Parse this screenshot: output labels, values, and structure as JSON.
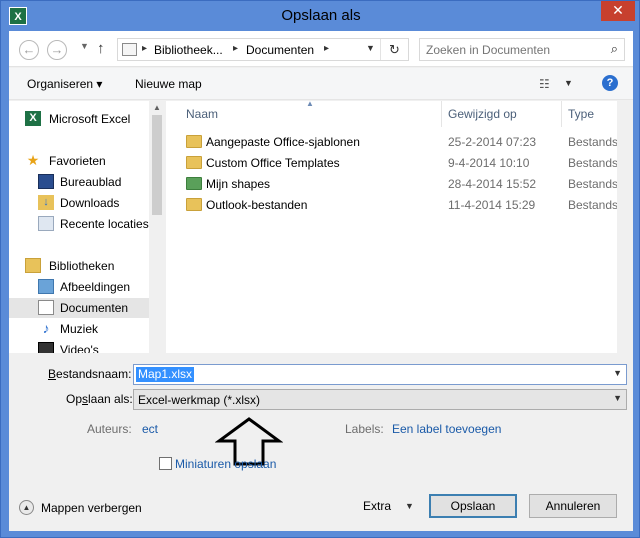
{
  "window": {
    "title": "Opslaan als",
    "app_icon_text": "X",
    "close_glyph": "✕"
  },
  "address": {
    "back_glyph": "←",
    "forward_glyph": "→",
    "up_glyph": "↑",
    "crumbs": [
      "Bibliotheek...",
      "Documenten"
    ],
    "refresh_glyph": "↻",
    "search_placeholder": "Zoeken in Documenten"
  },
  "toolbar": {
    "organize_label": "Organiseren ▾",
    "new_folder_label": "Nieuwe map",
    "view_glyph": "☷",
    "help_glyph": "?"
  },
  "nav": {
    "items": [
      {
        "label": "Microsoft Excel",
        "icon": "excel-icon"
      },
      {
        "label": "Favorieten",
        "icon": "star-icon"
      },
      {
        "label": "Bureaublad",
        "icon": "desktop-icon"
      },
      {
        "label": "Downloads",
        "icon": "downloads-icon"
      },
      {
        "label": "Recente locaties",
        "icon": "recent-places-icon"
      },
      {
        "label": "Bibliotheken",
        "icon": "libraries-icon"
      },
      {
        "label": "Afbeeldingen",
        "icon": "pictures-icon"
      },
      {
        "label": "Documenten",
        "icon": "documents-icon"
      },
      {
        "label": "Muziek",
        "icon": "music-icon"
      },
      {
        "label": "Video's",
        "icon": "video-icon"
      }
    ]
  },
  "files": {
    "columns": [
      "Naam",
      "Gewijzigd op",
      "Type"
    ],
    "rows": [
      {
        "name": "Aangepaste Office-sjablonen",
        "date": "25-2-2014 07:23",
        "type": "Bestandsmap"
      },
      {
        "name": "Custom Office Templates",
        "date": "9-4-2014 10:10",
        "type": "Bestandsmap"
      },
      {
        "name": "Mijn shapes",
        "date": "28-4-2014 15:52",
        "type": "Bestandsmap"
      },
      {
        "name": "Outlook-bestanden",
        "date": "11-4-2014 15:29",
        "type": "Bestandsmap"
      }
    ]
  },
  "form": {
    "filename_label_u": "B",
    "filename_label_rest": "estandsnaam:",
    "filename_value": "Map1.xlsx",
    "savetype_label_pre": "Op",
    "savetype_label_u": "s",
    "savetype_label_rest": "laan als:",
    "savetype_value": "Excel-werkmap (*.xlsx)",
    "authors_label": "Auteurs:",
    "authors_value": "ect",
    "tags_label": "Labels:",
    "tags_value": "Een label toevoegen",
    "thumbnails_label": "Miniaturen opslaan",
    "hide_folders_label": "Mappen verbergen",
    "extra_label": "Extra",
    "save_label": "Opslaan",
    "cancel_label": "Annuleren"
  },
  "colors": {
    "window_frame": "#5a8bd8",
    "close_button": "#c7402e",
    "selection": "#3390ff",
    "link": "#1a5aa8"
  }
}
